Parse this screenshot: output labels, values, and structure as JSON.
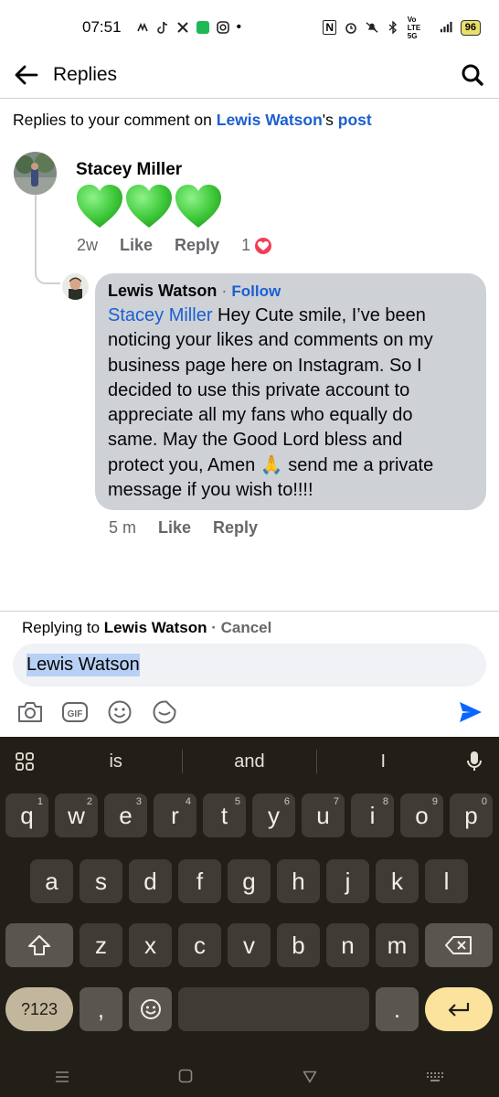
{
  "status_bar": {
    "time": "07:51",
    "app_icons": [
      "messenger-icon",
      "tiktok-icon",
      "x-icon",
      "green-app-icon",
      "instagram-icon"
    ],
    "more_dot": "•",
    "nfc": "N",
    "network": "Vo LTE 5G",
    "battery": "96"
  },
  "header": {
    "title": "Replies"
  },
  "context": {
    "prefix": "Replies to your comment on ",
    "author": "Lewis Watson",
    "middle": "'s ",
    "post": "post"
  },
  "comment": {
    "name": "Stacey Miller",
    "hearts": [
      "green-heart",
      "green-heart",
      "green-heart"
    ],
    "time": "2w",
    "like": "Like",
    "reply": "Reply",
    "reaction_count": "1"
  },
  "reply": {
    "name": "Lewis Watson",
    "dot": " · ",
    "follow": "Follow",
    "mention": "Stacey Miller",
    "text_lines": [
      " Hey Cute smile, I’ve been",
      "noticing your likes and comments on my",
      "business page here on Instagram. So I",
      "decided to use this private account to",
      "appreciate all my fans who equally do",
      "same. May the Good Lord bless and",
      "protect you, Amen 🙏 send me a private",
      "message if you wish to!!!!"
    ],
    "time": "5 m",
    "like": "Like",
    "reply": "Reply"
  },
  "composer": {
    "replying_prefix": "Replying to ",
    "replying_name": "Lewis Watson",
    "dot": " · ",
    "cancel": "Cancel",
    "input_value": "Lewis Watson"
  },
  "keyboard": {
    "suggestions": [
      "is",
      "and",
      "I"
    ],
    "row1": [
      "q",
      "w",
      "e",
      "r",
      "t",
      "y",
      "u",
      "i",
      "o",
      "p"
    ],
    "row1_numbers": [
      "1",
      "2",
      "3",
      "4",
      "5",
      "6",
      "7",
      "8",
      "9",
      "0"
    ],
    "row2": [
      "a",
      "s",
      "d",
      "f",
      "g",
      "h",
      "j",
      "k",
      "l"
    ],
    "row3": [
      "z",
      "x",
      "c",
      "v",
      "b",
      "n",
      "m"
    ],
    "symbols_key": "?123",
    "comma": ",",
    "period": "."
  },
  "colors": {
    "link": "#1b5fd1",
    "bubble": "#ced1d6",
    "heart": "#3fc93a",
    "keyboard_bg": "#221f19"
  }
}
